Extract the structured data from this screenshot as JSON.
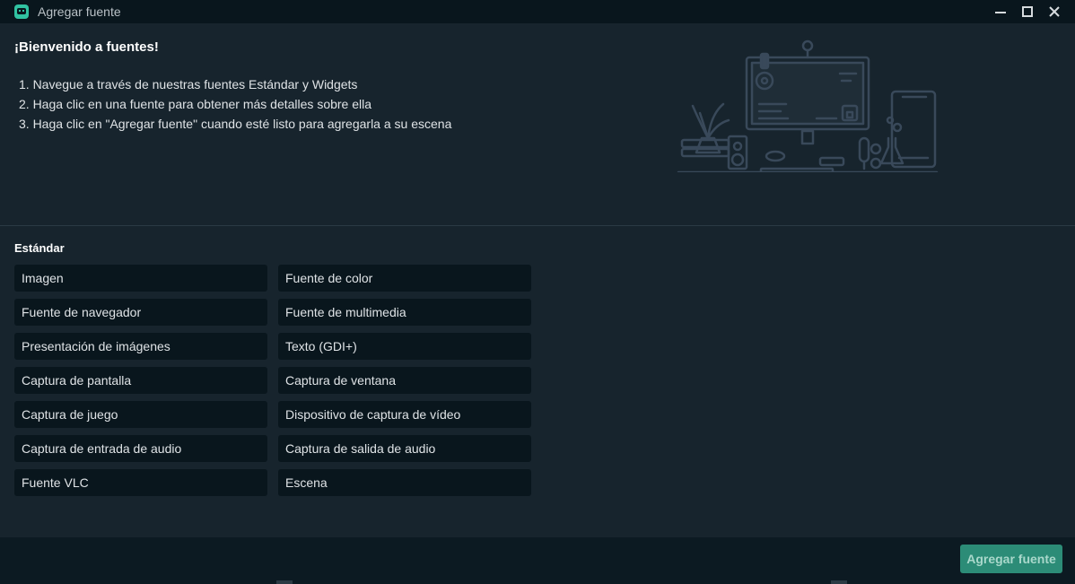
{
  "window": {
    "title": "Agregar fuente",
    "controls": [
      "minimize-icon",
      "maximize-icon",
      "close-icon"
    ]
  },
  "welcome": {
    "heading": "¡Bienvenido a fuentes!",
    "steps": [
      "1. Navegue a través de nuestras fuentes Estándar y Widgets",
      "2. Haga clic en una fuente para obtener más detalles sobre ella",
      "3. Haga clic en \"Agregar fuente\" cuando esté listo para agregarla a su escena"
    ]
  },
  "standard": {
    "title": "Estándar",
    "sources": [
      "Imagen",
      "Fuente de color",
      "Fuente de navegador",
      "Fuente de multimedia",
      "Presentación de imágenes",
      "Texto (GDI+)",
      "Captura de pantalla",
      "Captura de ventana",
      "Captura de juego",
      "Dispositivo de captura de vídeo",
      "Captura de entrada de audio",
      "Captura de salida de audio",
      "Fuente VLC",
      "Escena"
    ]
  },
  "footer": {
    "add_source_label": "Agregar fuente"
  },
  "colors": {
    "background": "#17242d",
    "titlebar": "#09161d",
    "button": "#09161d",
    "accent": "#31c3a2",
    "primary_button": "#2c8c77"
  }
}
